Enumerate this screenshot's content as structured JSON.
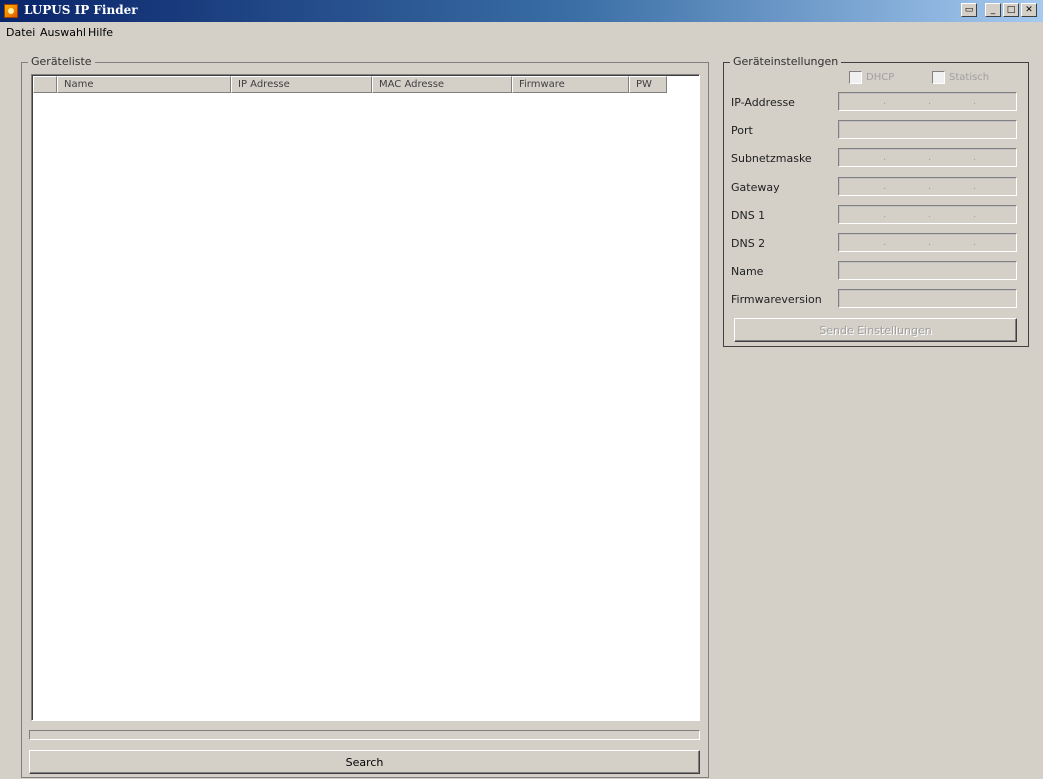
{
  "window": {
    "title": "LUPUS IP Finder"
  },
  "menu": {
    "items": [
      "Datei",
      "Auswahl",
      "Hilfe"
    ]
  },
  "device_list": {
    "legend": "Geräteliste",
    "columns": [
      "Name",
      "IP Adresse",
      "MAC Adresse",
      "Firmware",
      "PW"
    ]
  },
  "search_button": "Search",
  "settings": {
    "legend": "Geräteinstellungen",
    "dhcp_label": "DHCP",
    "static_label": "Statisch",
    "fields": {
      "ip": "IP-Addresse",
      "port": "Port",
      "subnet": "Subnetzmaske",
      "gateway": "Gateway",
      "dns1": "DNS 1",
      "dns2": "DNS 2",
      "name": "Name",
      "firmware": "Firmwareversion"
    },
    "send_button": "Sende Einstellungen"
  },
  "colors": {
    "titlebar_start": "#0a246a",
    "face": "#d4d0c8"
  }
}
